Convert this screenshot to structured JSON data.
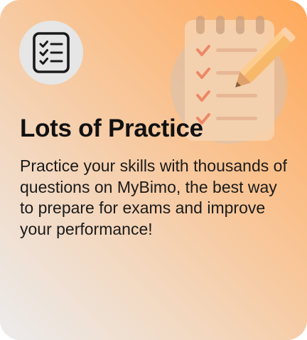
{
  "card": {
    "title": "Lots of Practice",
    "description": "Practice your skills with thousands of questions on MyBimo, the best way to prepare for exams and improve your performance!",
    "icon": "checklist-icon",
    "illustration": "clipboard-pencil-illustration"
  },
  "colors": {
    "gradient_start": "#ffa95a",
    "gradient_end": "#ececec",
    "icon_badge": "#e6e6e6",
    "title_text": "#111111"
  }
}
